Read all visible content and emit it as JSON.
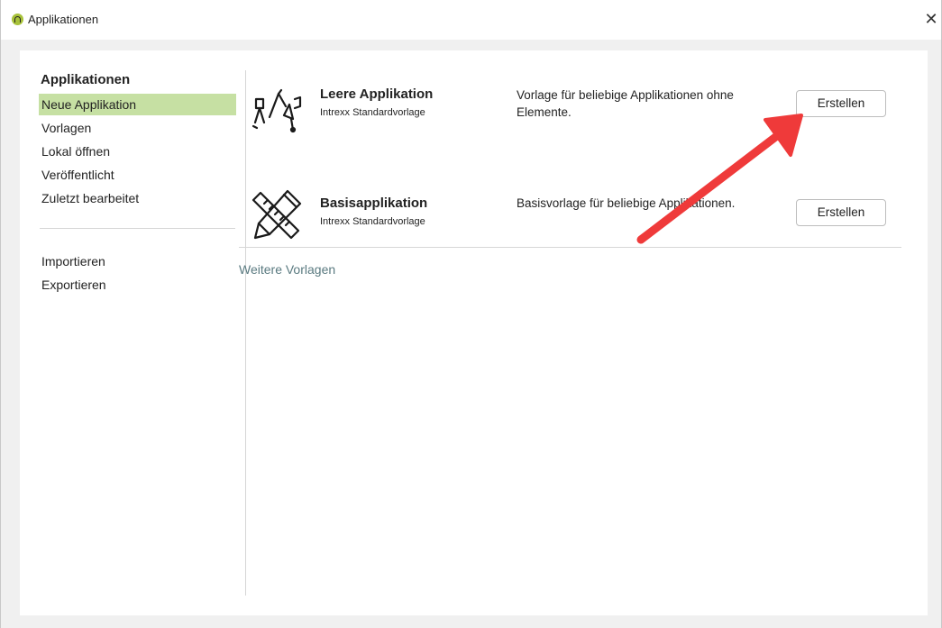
{
  "window": {
    "title": "Applikationen",
    "close_glyph": "✕"
  },
  "sidebar": {
    "heading": "Applikationen",
    "items": [
      {
        "label": "Neue Applikation",
        "selected": true
      },
      {
        "label": "Vorlagen"
      },
      {
        "label": "Lokal öffnen"
      },
      {
        "label": "Veröffentlicht"
      },
      {
        "label": "Zuletzt bearbeitet"
      }
    ],
    "actions": [
      {
        "label": "Importieren"
      },
      {
        "label": "Exportieren"
      }
    ]
  },
  "templates": [
    {
      "icon": "design-tools-icon",
      "title": "Leere Applikation",
      "subtitle": "Intrexx Standardvorlage",
      "description": "Vorlage für beliebige Applikationen ohne Elemente.",
      "button": "Erstellen"
    },
    {
      "icon": "ruler-pencil-icon",
      "title": "Basisapplikation",
      "subtitle": "Intrexx Standardvorlage",
      "description": "Basisvorlage für beliebige Applikationen.",
      "button": "Erstellen"
    }
  ],
  "more_templates_link": "Weitere Vorlagen",
  "colors": {
    "selection": "#c6e0a3",
    "annotation_arrow": "#ef3a3a",
    "link": "#5a7a80"
  }
}
